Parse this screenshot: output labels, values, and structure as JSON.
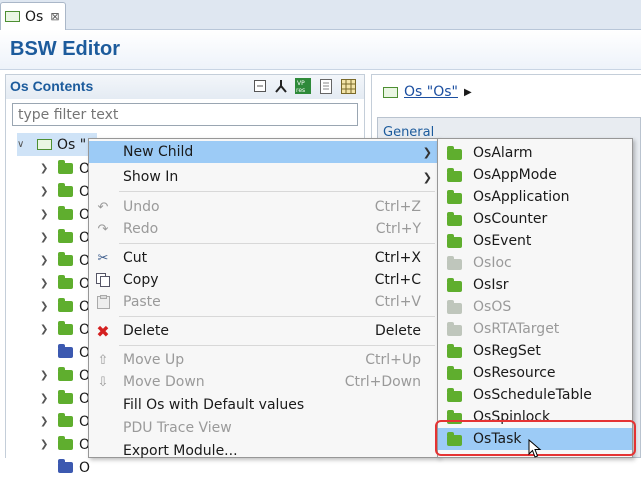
{
  "tab": {
    "label": "Os",
    "close": "⊠"
  },
  "editor": {
    "title": "BSW Editor"
  },
  "left": {
    "title": "Os Contents",
    "filter_placeholder": "type filter text",
    "root_label": "Os \"",
    "child_prefix": "O",
    "rows": [
      {
        "icon": "green"
      },
      {
        "icon": "green"
      },
      {
        "icon": "green"
      },
      {
        "icon": "green"
      },
      {
        "icon": "green"
      },
      {
        "icon": "green"
      },
      {
        "icon": "green"
      },
      {
        "icon": "green"
      },
      {
        "icon": "blue"
      },
      {
        "icon": "green"
      },
      {
        "icon": "green"
      },
      {
        "icon": "green"
      },
      {
        "icon": "green"
      },
      {
        "icon": "blue"
      }
    ]
  },
  "right": {
    "breadcrumb": "Os \"Os\"",
    "general": "General"
  },
  "menu": {
    "new_child": "New Child",
    "show_in": "Show In",
    "undo": "Undo",
    "undo_key": "Ctrl+Z",
    "redo": "Redo",
    "redo_key": "Ctrl+Y",
    "cut": "Cut",
    "cut_key": "Ctrl+X",
    "copy": "Copy",
    "copy_key": "Ctrl+C",
    "paste": "Paste",
    "paste_key": "Ctrl+V",
    "delete": "Delete",
    "delete_key": "Delete",
    "move_up": "Move Up",
    "move_up_key": "Ctrl+Up",
    "move_down": "Move Down",
    "move_down_key": "Ctrl+Down",
    "fill_defaults": "Fill Os with Default values",
    "pdu_trace": "PDU Trace View",
    "export_module": "Export Module..."
  },
  "submenu": {
    "items": [
      {
        "label": "OsAlarm",
        "enabled": true
      },
      {
        "label": "OsAppMode",
        "enabled": true
      },
      {
        "label": "OsApplication",
        "enabled": true
      },
      {
        "label": "OsCounter",
        "enabled": true
      },
      {
        "label": "OsEvent",
        "enabled": true
      },
      {
        "label": "OsIoc",
        "enabled": false
      },
      {
        "label": "OsIsr",
        "enabled": true
      },
      {
        "label": "OsOS",
        "enabled": false
      },
      {
        "label": "OsRTATarget",
        "enabled": false
      },
      {
        "label": "OsRegSet",
        "enabled": true
      },
      {
        "label": "OsResource",
        "enabled": true
      },
      {
        "label": "OsScheduleTable",
        "enabled": true
      },
      {
        "label": "OsSpinlock",
        "enabled": true
      },
      {
        "label": "OsTask",
        "enabled": true,
        "highlighted": true
      }
    ]
  },
  "colors": {
    "accent": "#1c5b9c",
    "highlight": "#9ccbf6",
    "callout": "#e53333"
  }
}
